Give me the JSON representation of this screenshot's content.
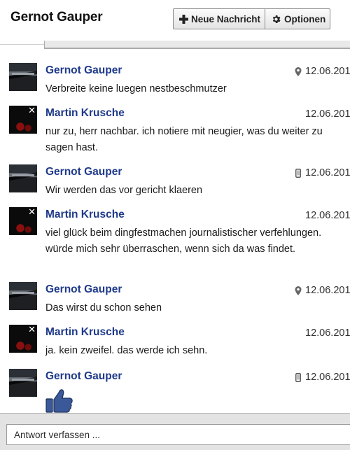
{
  "conversation": {
    "title": "Gernot Gauper"
  },
  "toolbar": {
    "new_message_label": "Neue Nachricht",
    "options_label": "Optionen",
    "new_message_icon": "plus-icon",
    "options_icon": "gear-icon"
  },
  "messages": [
    {
      "sender": "Gernot Gauper",
      "avatar": "gernot",
      "date": "12.06.201",
      "meta_icon": "location-pin-icon",
      "text": "Verbreite keine luegen nestbeschmutzer"
    },
    {
      "sender": "Martin Krusche",
      "avatar": "martin",
      "date": "12.06.201",
      "meta_icon": "",
      "text": "nur zu, herr nachbar. ich notiere mit neugier, was du weiter zu sagen hast."
    },
    {
      "sender": "Gernot Gauper",
      "avatar": "gernot",
      "date": "12.06.201",
      "meta_icon": "mobile-phone-icon",
      "text": "Wir werden das vor gericht klaeren"
    },
    {
      "sender": "Martin Krusche",
      "avatar": "martin",
      "date": "12.06.201",
      "meta_icon": "",
      "text": "viel glück beim dingfestmachen journalistischer verfehlungen. würde mich sehr überraschen, wenn sich da was findet."
    },
    {
      "sender": "Gernot Gauper",
      "avatar": "gernot",
      "date": "12.06.201",
      "meta_icon": "location-pin-icon",
      "text": "Das wirst du schon sehen"
    },
    {
      "sender": "Martin Krusche",
      "avatar": "martin",
      "date": "12.06.201",
      "meta_icon": "",
      "text": "ja. kein zweifel. das werde ich sehn."
    },
    {
      "sender": "Gernot Gauper",
      "avatar": "gernot",
      "date": "12.06.201",
      "meta_icon": "mobile-phone-icon",
      "text": "",
      "sticker": "thumbs-up-icon"
    }
  ],
  "composer": {
    "placeholder": "Antwort verfassen ..."
  },
  "colors": {
    "sender_name": "#1f3a8a",
    "like_blue": "#3b5998"
  }
}
